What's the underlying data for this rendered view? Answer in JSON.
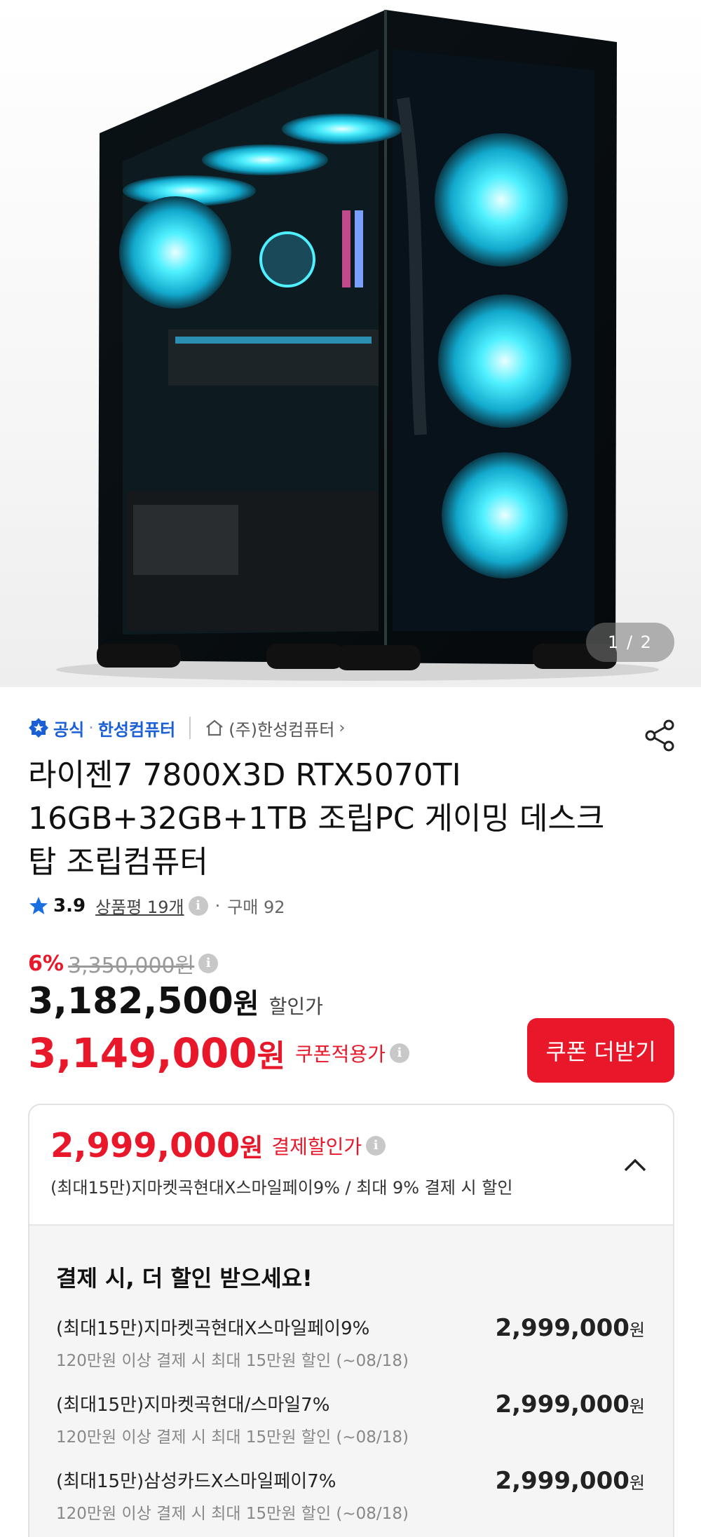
{
  "gallery": {
    "counter": "1 / 2",
    "image": "gaming-pc-case-icon"
  },
  "seller": {
    "official_label": "공식",
    "brand": "한성컴퓨터",
    "store": "(주)한성컴퓨터",
    "icons": [
      "verified-badge-icon",
      "home-icon",
      "chevron-right-icon",
      "share-icon"
    ]
  },
  "product": {
    "title": "라이젠7 7800X3D RTX5070TI 16GB+32GB+1TB 조립PC 게이밍 데스크탑 조립컴퓨터"
  },
  "rating": {
    "score": "3.9",
    "reviews": "상품평 19개",
    "purchases": "구매 92"
  },
  "pricing": {
    "discount_pct": "6%",
    "original_price": "3,350,000원",
    "sale_price": "3,182,500",
    "sale_unit": "원",
    "sale_label": "할인가",
    "coupon_price": "3,149,000",
    "coupon_unit": "원",
    "coupon_label": "쿠폰적용가",
    "coupon_button": "쿠폰 더받기",
    "accent_color": "#e8172a"
  },
  "payment_card": {
    "price": "2,999,000",
    "unit": "원",
    "label": "결제할인가",
    "summary": "(최대15만)지마켓곡현대X스마일페이9% / 최대 9% 결제 시 할인",
    "body_title": "결제 시, 더 할인 받으세요!",
    "offers": [
      {
        "name": "(최대15만)지마켓곡현대X스마일페이9%",
        "desc": "120만원 이상 결제 시 최대 15만원 할인 (~08/18)",
        "price": "2,999,000",
        "unit": "원"
      },
      {
        "name": "(최대15만)지마켓곡현대/스마일7%",
        "desc": "120만원 이상 결제 시 최대 15만원 할인 (~08/18)",
        "price": "2,999,000",
        "unit": "원"
      },
      {
        "name": "(최대15만)삼성카드X스마일페이7%",
        "desc": "120만원 이상 결제 시 최대 15만원 할인 (~08/18)",
        "price": "2,999,000",
        "unit": "원"
      }
    ]
  }
}
